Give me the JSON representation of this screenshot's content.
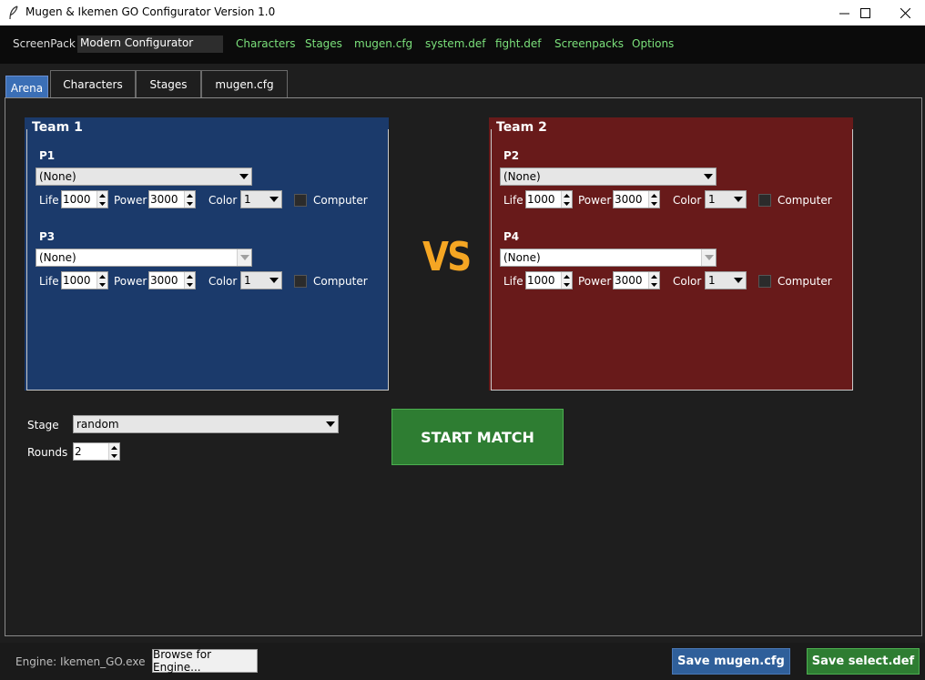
{
  "window": {
    "title": "Mugen & Ikemen GO Configurator Version 1.0"
  },
  "menubar": {
    "screenpack_label": "ScreenPack",
    "screenpack_value": "Modern Configurator",
    "items": [
      "Characters",
      "Stages",
      "mugen.cfg",
      "system.def",
      "fight.def",
      "Screenpacks",
      "Options"
    ]
  },
  "tabs": [
    {
      "label": "Arena",
      "active": true
    },
    {
      "label": "Characters",
      "active": false
    },
    {
      "label": "Stages",
      "active": false
    },
    {
      "label": "mugen.cfg",
      "active": false
    }
  ],
  "teams": {
    "team1": {
      "title": "Team 1",
      "color": "#1b3a6b",
      "players": [
        {
          "label": "P1",
          "character": "(None)",
          "life": "1000",
          "power": "3000",
          "color": "1",
          "computer": false
        },
        {
          "label": "P3",
          "character": "(None)",
          "life": "1000",
          "power": "3000",
          "color": "1",
          "computer": false
        }
      ]
    },
    "team2": {
      "title": "Team 2",
      "color": "#681a1a",
      "players": [
        {
          "label": "P2",
          "character": "(None)",
          "life": "1000",
          "power": "3000",
          "color": "1",
          "computer": false
        },
        {
          "label": "P4",
          "character": "(None)",
          "life": "1000",
          "power": "3000",
          "color": "1",
          "computer": false
        }
      ]
    }
  },
  "labels": {
    "life": "Life",
    "power": "Power",
    "color": "Color",
    "computer": "Computer"
  },
  "vs_text": "VS",
  "match": {
    "stage_label": "Stage",
    "stage_value": "random",
    "rounds_label": "Rounds",
    "rounds_value": "2",
    "start_label": "START MATCH"
  },
  "footer": {
    "engine_text": "Engine: Ikemen_GO.exe",
    "browse_label": "Browse for Engine...",
    "save_cfg_label": "Save mugen.cfg",
    "save_select_label": "Save select.def"
  },
  "colors": {
    "accent_green": "#2e7d32",
    "accent_blue": "#2f5f9a",
    "menu_text": "#7be07b",
    "vs_orange": "#f5a623"
  }
}
